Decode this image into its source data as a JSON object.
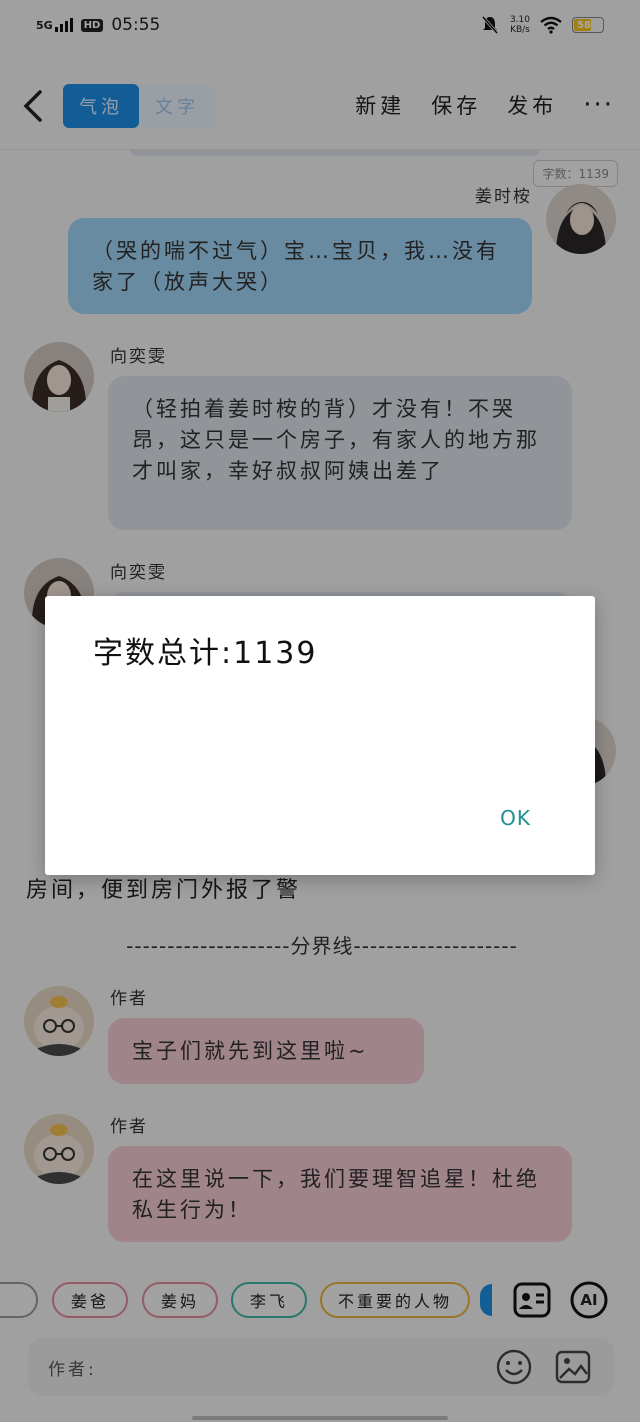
{
  "status": {
    "network": "5G",
    "hd": "HD",
    "time": "05:55",
    "speed_value": "3.10",
    "speed_unit": "KB/s",
    "battery": "58"
  },
  "appbar": {
    "tabs": [
      "气泡",
      "文字"
    ],
    "actions": [
      "新建",
      "保存",
      "发布"
    ],
    "more": "···"
  },
  "chat": {
    "wordcount_badge": "字数：1139",
    "msg1": {
      "name": "姜时桉",
      "text": "（哭的喘不过气）宝…宝贝，我…没有家了（放声大哭）"
    },
    "msg2": {
      "name": "向奕雯",
      "text": "（轻拍着姜时桉的背）才没有！不哭昂，这只是一个房子，有家人的地方那才叫家，幸好叔叔阿姨出差了"
    },
    "msg3": {
      "name": "向奕雯"
    },
    "plain_text": "房间，便到房门外报了警",
    "divider": "--------------------分界线--------------------",
    "msg4": {
      "name": "作者",
      "text": "宝子们就先到这里啦~"
    },
    "msg5": {
      "name": "作者",
      "text": "在这里说一下，我们要理智追星！杜绝私生行为！"
    }
  },
  "chips": [
    "姜爸",
    "姜妈",
    "李飞",
    "不重要的人物"
  ],
  "chip_colors": [
    "#e38a9a",
    "#e38a9a",
    "#3fb5a8",
    "#e9b33a"
  ],
  "ai_label": "AI",
  "input": {
    "label": "作者:"
  },
  "dialog": {
    "message": "字数总计:1139",
    "ok": "OK"
  }
}
